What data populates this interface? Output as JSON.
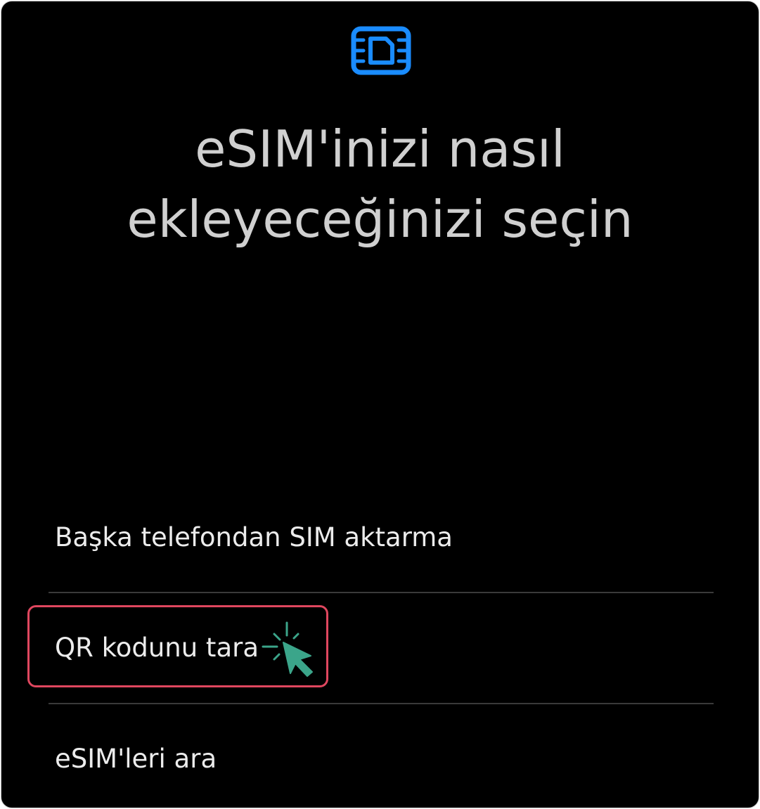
{
  "header": {
    "icon": "esim-card-icon",
    "title_line1": "eSIM'inizi nasıl",
    "title_line2": "ekleyeceğinizi seçin"
  },
  "options": [
    {
      "label": "Başka telefondan SIM aktarma"
    },
    {
      "label": "QR kodunu tara"
    },
    {
      "label": "eSIM'leri ara"
    }
  ],
  "annotation": {
    "highlight_color": "#e0475f",
    "cursor_icon": "click-cursor-icon",
    "cursor_color": "#3ba58a"
  },
  "colors": {
    "background": "#000000",
    "accent": "#1a8cff",
    "title_text": "#d0d0d0",
    "option_text": "#ececec"
  }
}
